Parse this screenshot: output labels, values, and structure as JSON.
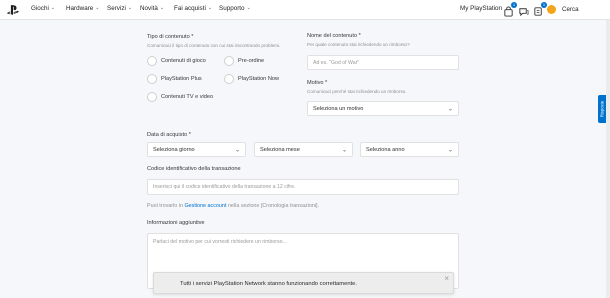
{
  "nav": {
    "items": [
      {
        "label": "Giochi"
      },
      {
        "label": "Hardware"
      },
      {
        "label": "Servizi"
      },
      {
        "label": "Novità"
      },
      {
        "label": "Fai acquisti"
      },
      {
        "label": "Supporto"
      }
    ],
    "my_playstation": "My PlayStation",
    "search": "Cerca",
    "notification_count": "1",
    "accent": "#0072ce",
    "avatar_color": "#f2a51a"
  },
  "form": {
    "content_type": {
      "label": "Tipo di contenuto",
      "required_mark": "*",
      "hint": "Comunicaci il tipo di contenuto con cui stai riscontrando problemi.",
      "options": [
        "Contenuti di gioco",
        "Pre-ordine",
        "PlayStation Plus",
        "PlayStation Now",
        "Contenuti TV e video"
      ]
    },
    "content_name": {
      "label": "Nome del contenuto",
      "required_mark": "*",
      "hint": "Per quale contenuto stai richiedendo un rimborso?",
      "placeholder": "Ad es. \"God of War\""
    },
    "reason": {
      "label": "Motivo",
      "required_mark": "*",
      "hint": "Comunicaci perché stai richiedendo un rimborso.",
      "select_value": "Seleziona un motivo"
    },
    "purchase_date": {
      "label": "Data di acquisto",
      "required_mark": "*",
      "day": "Seleziona giorno",
      "month": "Seleziona mese",
      "year": "Seleziona anno"
    },
    "transaction_id": {
      "label": "Codice identificativo della transazione",
      "placeholder": "Inserisci qui il codice identificativo della transazione a 12 cifre.",
      "info_prefix": "Puoi trovarlo in",
      "info_link": "Gestione account",
      "info_suffix": "nella sezione [Cronologia transazioni]."
    },
    "additional_info": {
      "label": "Informazioni aggiuntive",
      "placeholder": "Parlaci del motivo per cui vorresti richiedere un rimborso..."
    }
  },
  "side_tab": {
    "label": "Risposte"
  },
  "toast": {
    "text": "Tutti i servizi PlayStation Network stanno funzionando correttamente.",
    "close": "×"
  }
}
